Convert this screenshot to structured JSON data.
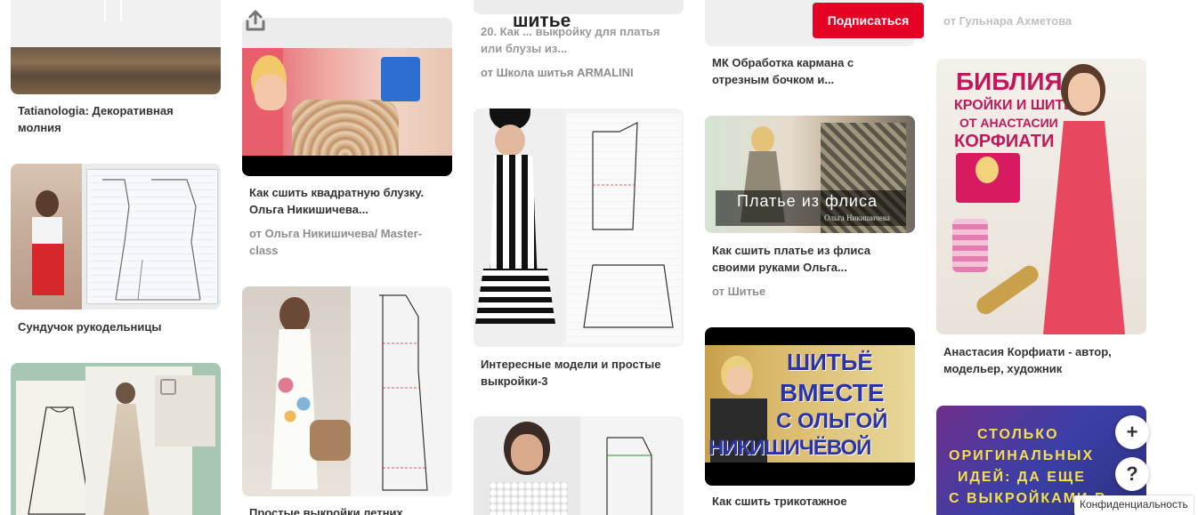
{
  "header": {
    "board_title": "шитье",
    "subscribe_label": "Подписаться"
  },
  "columns": {
    "c1": [
      {
        "caption": "Tatianologia: Декоративная молния"
      },
      {
        "caption": "Сундучок рукодельницы"
      },
      {
        "caption": ""
      }
    ],
    "c2": [
      {
        "caption": "Как сшить квадратную блузку. Ольга Никишичева...",
        "source": "от Ольга Никишичева/ Master-class"
      },
      {
        "caption": "Простые выкройки летних"
      }
    ],
    "c3": [
      {
        "caption": "20. Как ... выкройку для платья или блузы из...",
        "source": "от Школа шитья ARMALINI"
      },
      {
        "caption": "Интересные модели и простые выкройки-3"
      },
      {
        "caption": ""
      }
    ],
    "c4": [
      {
        "caption": "МК Обработка кармана с отрезным бочком и..."
      },
      {
        "caption": "Как сшить платье из флиса своими руками Ольга...",
        "source": "от Шитье",
        "overlay": "Платье из флиса",
        "overlay_sub": "Ольга Никишичева"
      },
      {
        "caption": "Как сшить трикотажное",
        "overlay_lines": [
          "ШИТЬЁ",
          "ВМЕСТЕ",
          "С ОЛЬГОЙ",
          "НИКИШИЧЁВОЙ"
        ]
      }
    ],
    "c5": [
      {
        "source": "от Гульнара Ахметова"
      },
      {
        "caption": "Анастасия Корфиати - автор, модельер, художник",
        "overlay_lines": [
          "БИБЛИЯ",
          "КРОЙКИ И ШИТЬЯ",
          "ОТ АНАСТАСИИ",
          "КОРФИАТИ"
        ]
      },
      {
        "overlay_lines": [
          "СТОЛЬКО",
          "ОРИГИНАЛЬНЫХ",
          "ИДЕЙ: ДА ЕЩЕ",
          "С ВЫКРОЙКАМИ В"
        ]
      }
    ]
  },
  "fab": {
    "add": "+",
    "help": "?"
  },
  "footer": {
    "privacy": "Конфиденциальность"
  },
  "icons": [
    "share-icon",
    "plus-icon",
    "help-icon"
  ],
  "colors": {
    "accent": "#e60023",
    "source_text": "#8e8e8e",
    "caption_text": "#333333"
  }
}
